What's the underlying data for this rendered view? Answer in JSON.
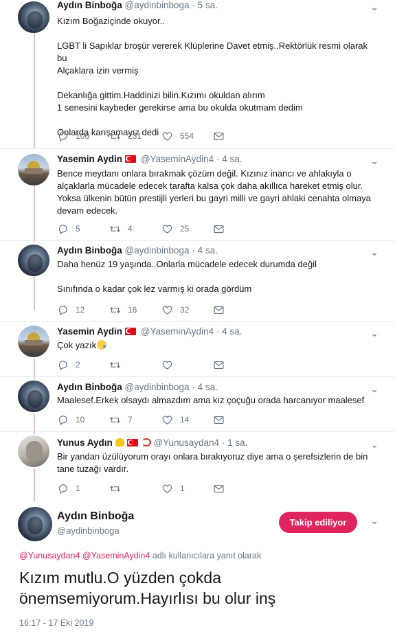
{
  "tweets": [
    {
      "name": "Aydın Binboğa",
      "handle": "@aydinbinboga",
      "time": "· 5 sa.",
      "lines": [
        "Kızım Boğaziçinde okuyor..",
        "",
        "LGBT li Sapıklar broşür vererek Klüplerine Davet etmiş..Rektörlük resmi olarak bu",
        "Alçaklara izin vermiş",
        "",
        "Dekanlığa gittim.Haddinizi bilin.Kızımı okuldan alırım",
        "1 senesini kaybeder gerekirse ama bu okulda okutmam dedim",
        "",
        "Onlarda karışamayız dedi"
      ],
      "replies": "106",
      "retweets": "231",
      "likes": "554"
    },
    {
      "name": "Yasemin Aydin",
      "handle": "@YaseminAydin4",
      "time": "· 4 sa.",
      "lines": [
        "Bence meydanı onlara bırakmak çözüm değil. Kızınız inancı ve ahlakıyla o",
        "alçaklarla mücadele edecek tarafta kalsa çok daha akıllıca hareket etmiş olur.",
        "Yoksa ülkenin bütün prestijli yerleri bu gayri milli ve gayri ahlaki cenahta olmaya",
        "devam edecek."
      ],
      "replies": "5",
      "retweets": "4",
      "likes": "25"
    },
    {
      "name": "Aydın Binboğa",
      "handle": "@aydinbinboga",
      "time": "· 4 sa.",
      "lines": [
        "Daha henüz 19 yaşında..Onlarla mücadele edecek durumda değil",
        "",
        "Sınıfında o kadar çok lez varmış ki orada gördüm"
      ],
      "replies": "12",
      "retweets": "16",
      "likes": "32"
    },
    {
      "name": "Yasemin Aydin",
      "handle": "@YaseminAydin4",
      "time": "· 4 sa.",
      "lines": [
        "Çok yazık"
      ],
      "replies": "2",
      "retweets": "",
      "likes": ""
    },
    {
      "name": "Aydın Binboğa",
      "handle": "@aydinbinboga",
      "time": "· 4 sa.",
      "lines": [
        "Maalesef.Erkek olsaydı almazdım ama kız çoçuğu orada harcanıyor maalesef"
      ],
      "replies": "10",
      "retweets": "7",
      "likes": "14"
    },
    {
      "name": "Yunus Aydın",
      "handle": "@Yunusaydan4",
      "time": "· 1 sa.",
      "lines": [
        "Bir yandan üzülüyorum orayı onlara bırakıyoruz diye ama o şerefsizlerin de bin",
        "tane tuzağı vardır."
      ],
      "replies": "1",
      "retweets": "",
      "likes": "1"
    }
  ],
  "main": {
    "name": "Aydın Binboğa",
    "handle": "@aydinbinboga",
    "follow_label": "Takip ediliyor",
    "reply_mention_1": "@Yunusaydan4",
    "reply_mention_2": "@YaseminAydin4",
    "reply_suffix": "adlı kullanıcılara yanıt olarak",
    "text_line_1": "Kızım mutlu.O yüzden çokda",
    "text_line_2": "önemsemiyorum.Hayırlısı bu olur inş",
    "timestamp": "16:17 - 17 Eki 2019"
  },
  "colors": {
    "accent": "#e0245e",
    "thread_line": "#e1c6d2",
    "muted": "#657786"
  }
}
